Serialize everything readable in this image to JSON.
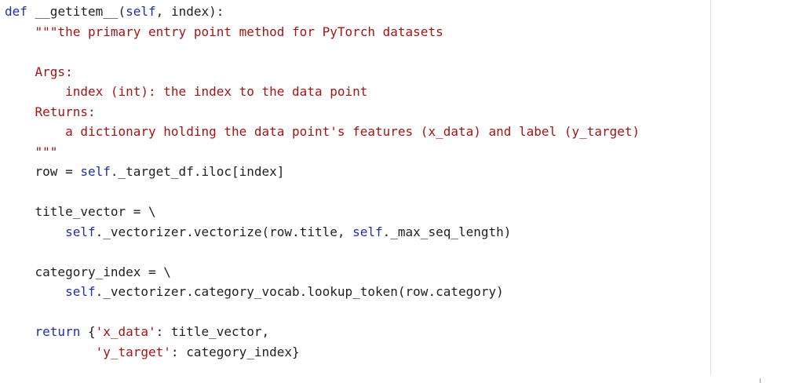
{
  "editor": {
    "language": "python",
    "lines": [
      [
        {
          "t": "def",
          "c": "kw"
        },
        {
          "t": " __getitem__(",
          "c": "plain"
        },
        {
          "t": "self",
          "c": "kw"
        },
        {
          "t": ", index):",
          "c": "plain"
        }
      ],
      [
        {
          "t": "    \"\"\"the primary entry point method for PyTorch datasets",
          "c": "str"
        }
      ],
      [],
      [
        {
          "t": "    Args:",
          "c": "str"
        }
      ],
      [
        {
          "t": "        index (int): the index to the data point",
          "c": "str"
        }
      ],
      [
        {
          "t": "    Returns:",
          "c": "str"
        }
      ],
      [
        {
          "t": "        a dictionary holding the data point's features (x_data) and label (y_target)",
          "c": "str"
        }
      ],
      [
        {
          "t": "    \"\"\"",
          "c": "str"
        }
      ],
      [
        {
          "t": "    row = ",
          "c": "plain"
        },
        {
          "t": "self",
          "c": "kw"
        },
        {
          "t": "._target_df.iloc[index]",
          "c": "plain"
        }
      ],
      [],
      [
        {
          "t": "    title_vector = \\",
          "c": "plain"
        }
      ],
      [
        {
          "t": "        ",
          "c": "plain"
        },
        {
          "t": "self",
          "c": "kw"
        },
        {
          "t": "._vectorizer.vectorize(row.title, ",
          "c": "plain"
        },
        {
          "t": "self",
          "c": "kw"
        },
        {
          "t": "._max_seq_length)",
          "c": "plain"
        }
      ],
      [],
      [
        {
          "t": "    category_index = \\",
          "c": "plain"
        }
      ],
      [
        {
          "t": "        ",
          "c": "plain"
        },
        {
          "t": "self",
          "c": "kw"
        },
        {
          "t": "._vectorizer.category_vocab.lookup_token(row.category)",
          "c": "plain"
        }
      ],
      [],
      [
        {
          "t": "    ",
          "c": "plain"
        },
        {
          "t": "return",
          "c": "kw"
        },
        {
          "t": " {",
          "c": "plain"
        },
        {
          "t": "'x_data'",
          "c": "str"
        },
        {
          "t": ": title_vector,",
          "c": "plain"
        }
      ],
      [
        {
          "t": "            ",
          "c": "plain"
        },
        {
          "t": "'y_target'",
          "c": "str"
        },
        {
          "t": ": category_index}",
          "c": "plain"
        }
      ]
    ]
  }
}
